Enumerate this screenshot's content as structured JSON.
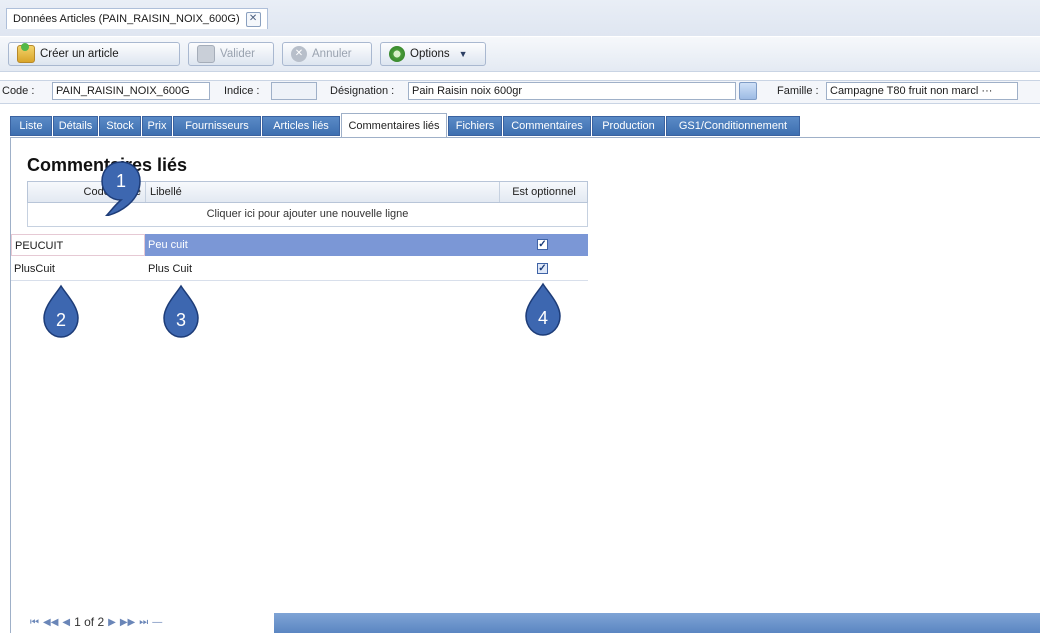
{
  "doc_tab": {
    "title": "Données Articles (PAIN_RAISIN_NOIX_600G)",
    "close": "✕"
  },
  "toolbar": {
    "create": "Créer un article",
    "validate": "Valider",
    "cancel": "Annuler",
    "options": "Options"
  },
  "fields": {
    "code_label": "Code :",
    "code_value": "PAIN_RAISIN_NOIX_600G",
    "indice_label": "Indice :",
    "indice_value": "",
    "designation_label": "Désignation :",
    "designation_value": "Pain Raisin noix 600gr",
    "famille_label": "Famille :",
    "famille_value": "Campagne T80 fruit non marcl ···"
  },
  "tabs": [
    "Liste",
    "Détails",
    "Stock",
    "Prix",
    "Fournisseurs",
    "Articles liés",
    "Commentaires liés",
    "Fichiers",
    "Commentaires",
    "Production",
    "GS1/Conditionnement"
  ],
  "active_tab": "Commentaires liés",
  "section_title": "Commentaires liés",
  "grid": {
    "headers": [
      "Code libellé",
      "Libellé",
      "Est optionnel"
    ],
    "add_row": "Cliquer ici pour ajouter une nouvelle ligne",
    "rows": [
      {
        "code": "PEUCUIT",
        "label": "Peu cuit",
        "optional": true,
        "selected": true
      },
      {
        "code": "PlusCuit",
        "label": "Plus Cuit",
        "optional": true,
        "selected": false
      }
    ]
  },
  "pager": {
    "text": "1 of 2"
  },
  "callouts": [
    "1",
    "2",
    "3",
    "4"
  ],
  "colors": {
    "selected_row": "#7b97d6",
    "callout": "#3d67b0",
    "tab": "#4a7bbd"
  }
}
